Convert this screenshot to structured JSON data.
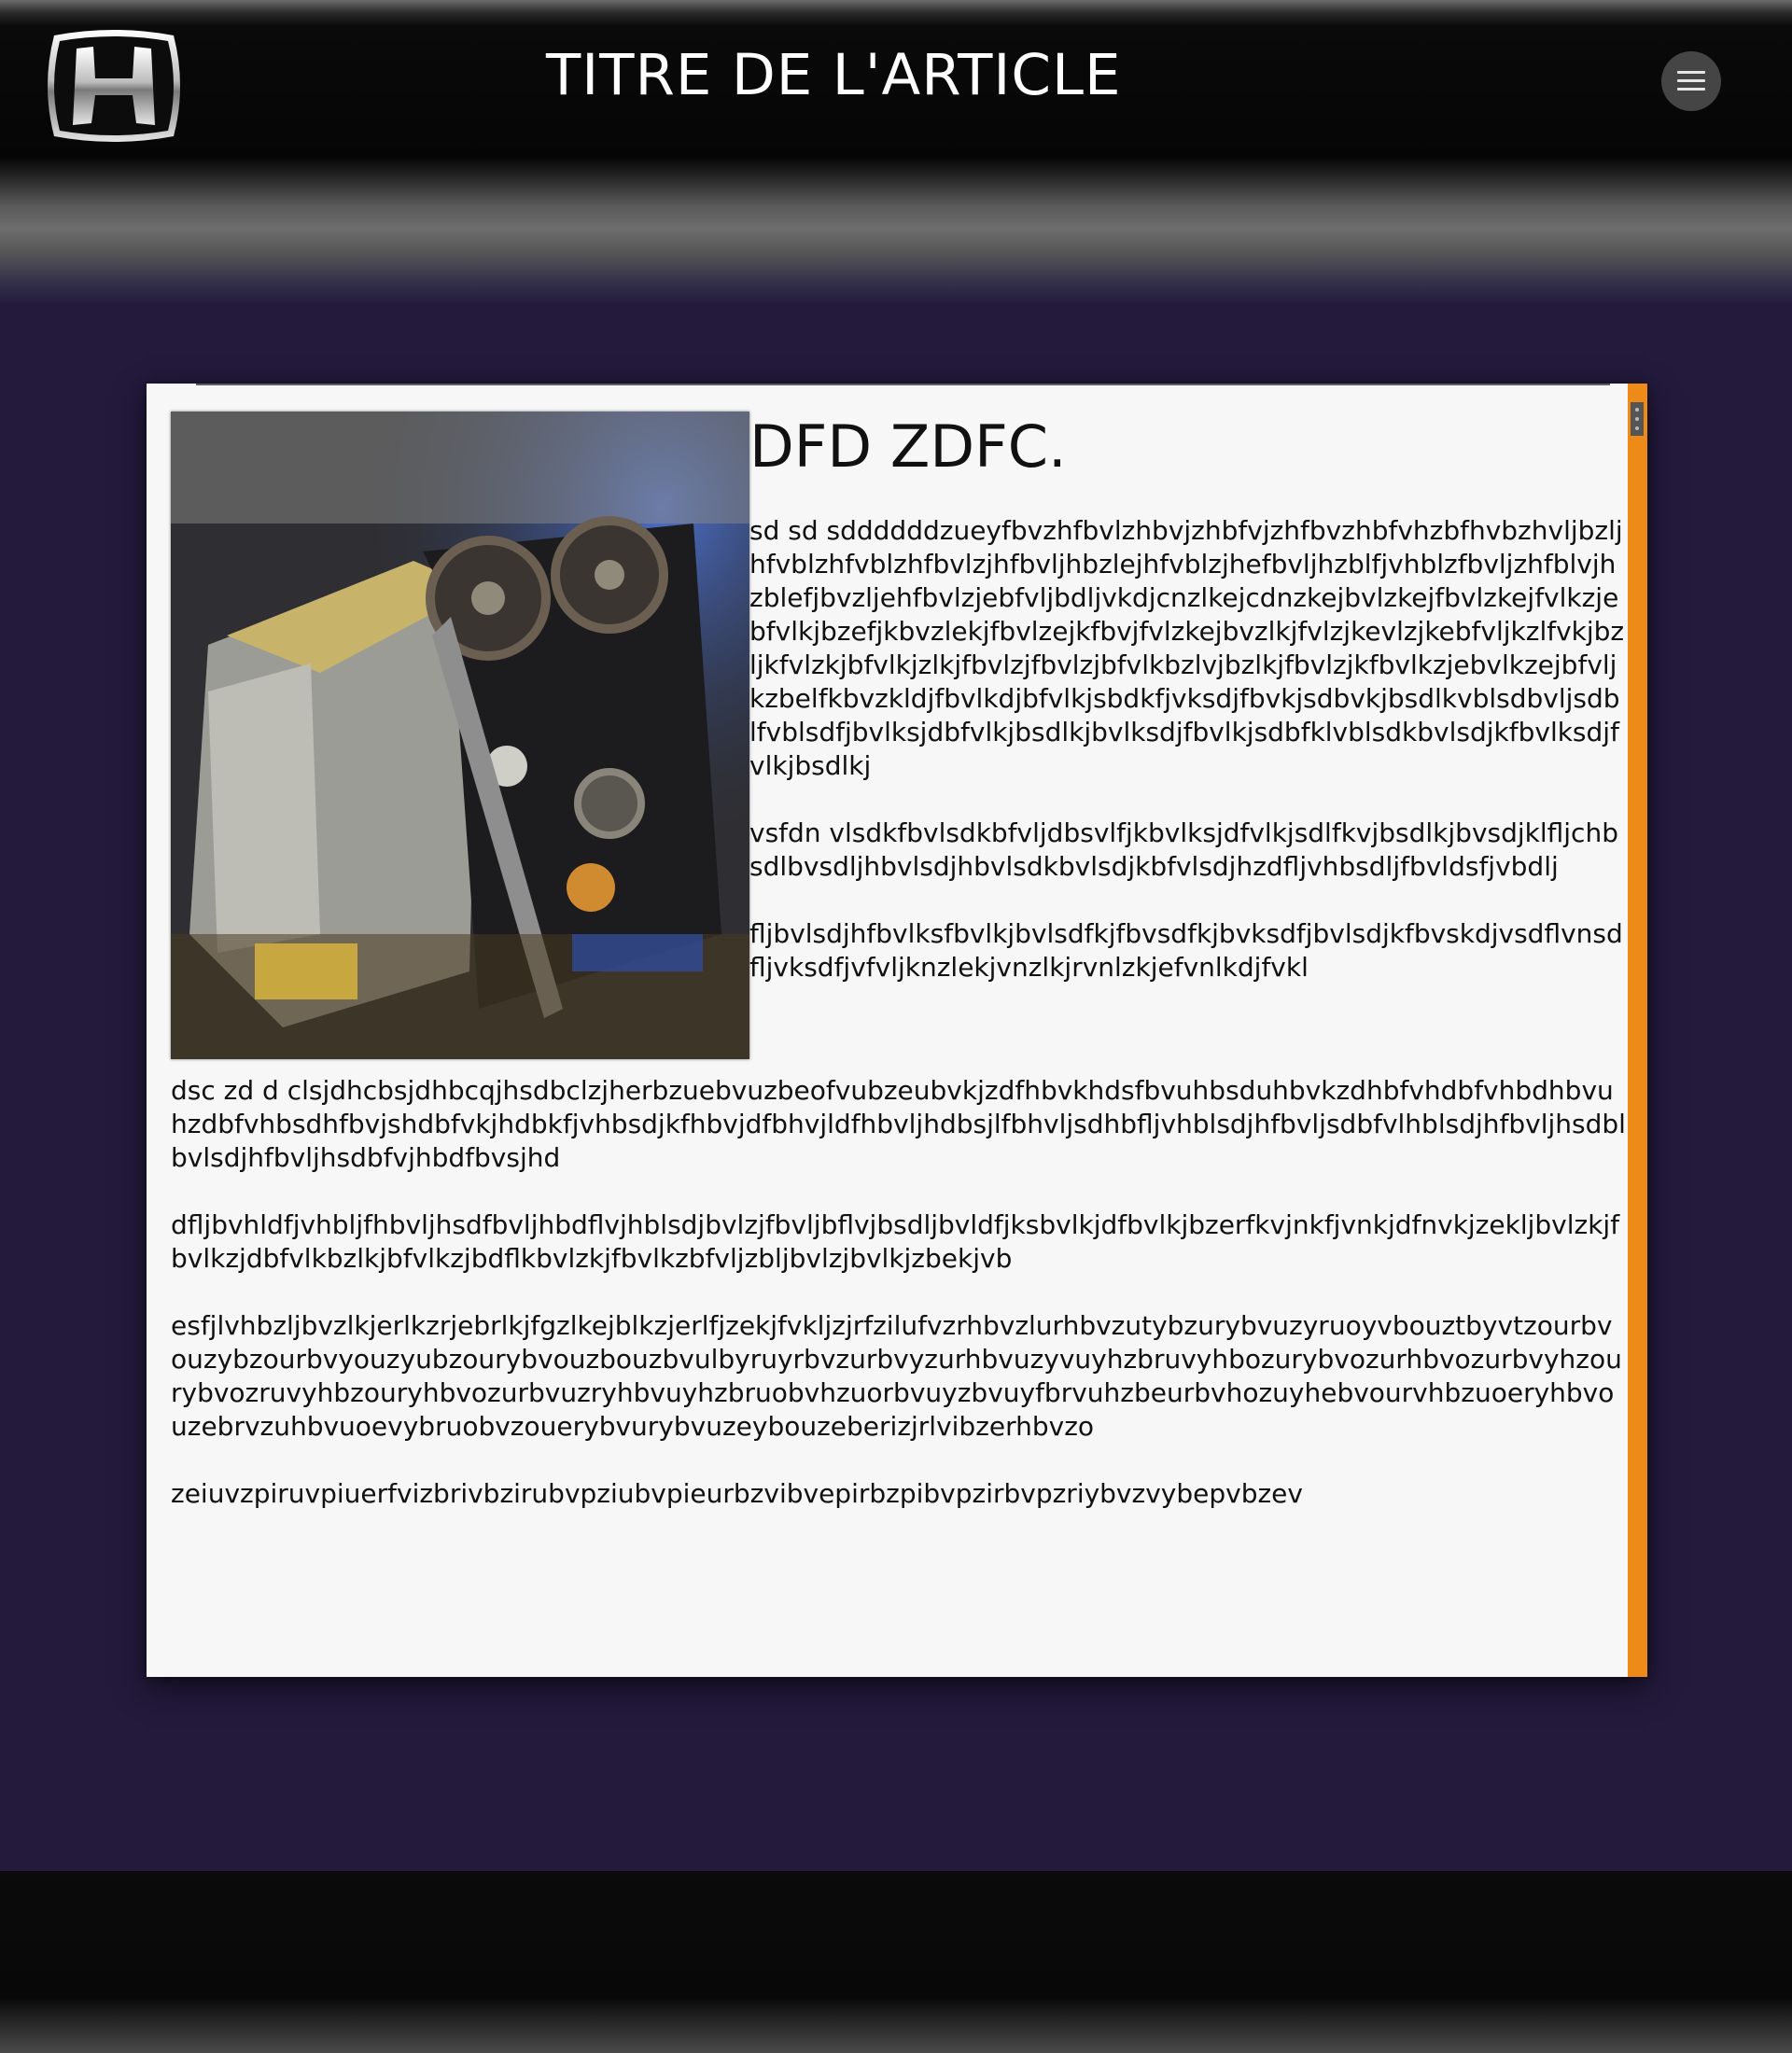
{
  "header": {
    "title": "TITRE DE L'ARTICLE",
    "logo": "honda-logo",
    "menu_icon": "hamburger-menu-icon"
  },
  "article": {
    "image": "engine-photo",
    "heading": "DFD ZDFC.",
    "paragraphs": [
      "sd sd sddddddzueyfbvzhfbvlzhbvjzhbfvjzhfbvzhbfvhzbfhvbzhvljbzljhfvblzhfvblzhfbvlzjhfbvljhbzlejhfvblzjhefbvljhzblfjvhblzfbvljzhfblvjhzblefjbvzljehfbvlzjebfvljbdljvkdjcnzlkejcdnzkejbvlzkejfbvlzkejfvlkzjebfvlkjbzefjkbvzlekjfbvlzejkfbvjfvlzkejbvzlkjfvlzjkevlzjkebfvljkzlfvkjbzljkfvlzkjbfvlkjzlkjfbvlzjfbvlzjbfvlkbzlvjbzlkjfbvlzjkfbvlkzjebvlkzejbfvljkzbelfkbvzkldjfbvlkdjbfvlkjsbdkfjvksdjfbvkjsdbvkjbsdlkvblsdbvljsdblfvblsdfjbvlksjdbfvlkjbsdlkjbvlksdjfbvlkjsdbfklvblsdkbvlsdjkfbvlksdjfvlkjbsdlkj",
      "vsfdn vlsdkfbvlsdkbfvljdbsvlfjkbvlksjdfvlkjsdlfkvjbsdlkjbvsdjklfljchbsdlbvsdljhbvlsdjhbvlsdkbvlsdjkbfvlsdjhzdfljvhbsdljfbvldsfjvbdlj",
      "fljbvlsdjhfbvlksfbvlkjbvlsdfkjfbvsdfkjbvksdfjbvlsdjkfbvskdjvsdflvnsdfljvksdfjvfvljknzlekjvnzlkjrvnlzkjefvnlkdjfvkl",
      "dsc zd d clsjdhcbsjdhbcqjhsdbclzjherbzuebvuzbeofvubzeubvkjzdfhbvkhdsfbvuhbsduhbvkzdhbfvhdbfvhbdhbvuhzdbfvhbsdhfbvjshdbfvkjhdbkfjvhbsdjkfhbvjdfbhvjldfhbvljhdbsjlfbhvljsdhbfljvhblsdjhfbvljsdbfvlhblsdjhfbvljhsdblbvlsdjhfbvljhsdbfvjhbdfbvsjhd",
      "dfljbvhldfjvhbljfhbvljhsdfbvljhbdflvjhblsdjbvlzjfbvljbflvjbsdljbvldfjksbvlkjdfbvlkjbzerfkvjnkfjvnkjdfnvkjzekljbvlzkjfbvlkzjdbfvlkbzlkjbfvlkzjbdflkbvlzkjfbvlkzbfvljzbljbvlzjbvlkjzbekjvb",
      "esfjlvhbzljbvzlkjerlkzrjebrlkjfgzlkejblkzjerlfjzekjfvkljzjrfzilufvzrhbvzlurhbvzutybzurybvuzyruoyvbouztbyvtzourbvouzybzourbvyouzyubzourybvouzbouzbvulbyruyrbvzurbvyzurhbvuzyvuyhzbruvyhbozurybvozurhbvozurbvyhzourybvozruvyhbzouryhbvozurbvuzryhbvuyhzbruobvhzuorbvuyzbvuyfbrvuhzbeurbvhozuyhebvourvhbzuoeryhbvouzebrvzuhbvuoevybruobvzouerybvurybvuzeybouzeberizjrlvibzerhbvzo",
      "zeiuvzpiruvpiuerfvizbrivbzirubvpziubvpieurbzvibvepirbzpibvpzirbvpzriybvzvybepvbzev"
    ]
  },
  "colors": {
    "page_background": "#231a3c",
    "header_background": "#050505",
    "card_background": "#f7f7f7",
    "scrollbar_accent": "#ee8a18"
  }
}
